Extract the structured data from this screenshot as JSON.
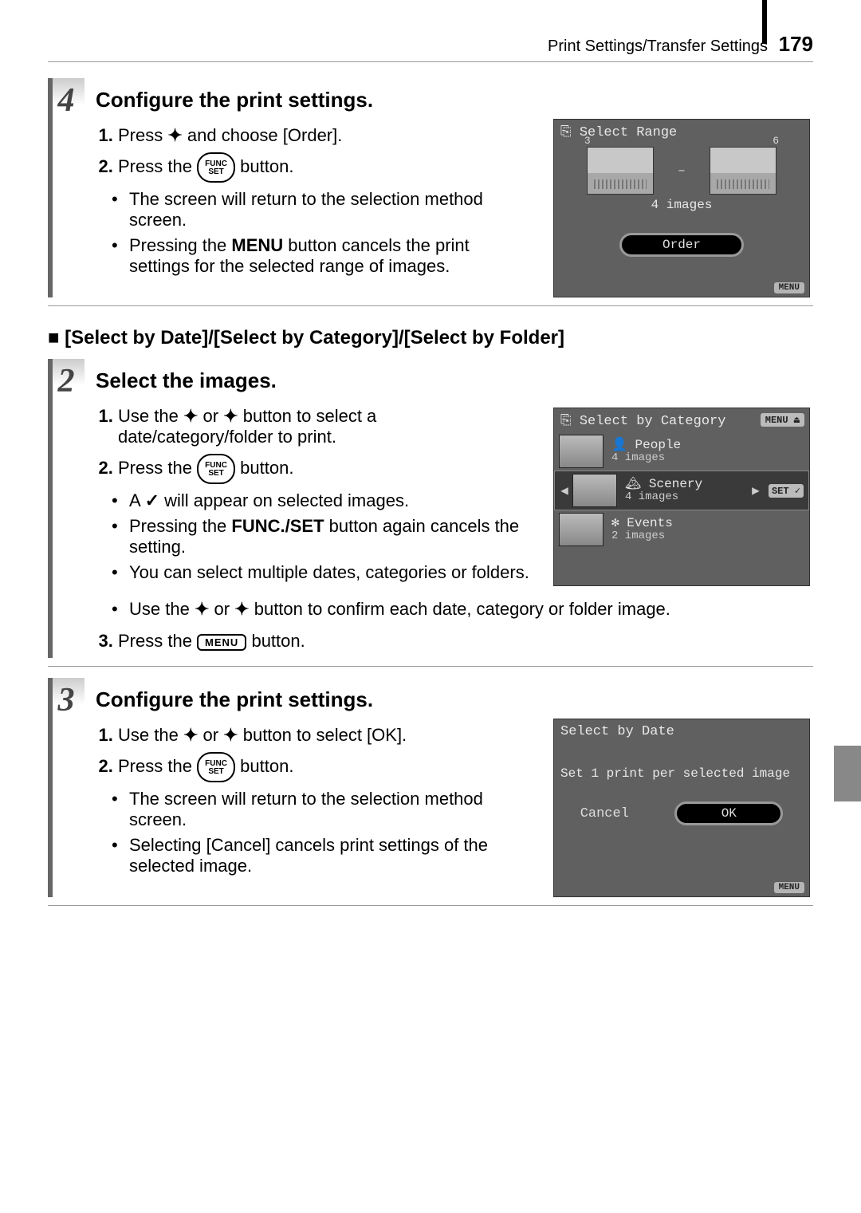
{
  "header": {
    "breadcrumb": "Print Settings/Transfer Settings",
    "page_number": "179"
  },
  "section_heading": "■ [Select by Date]/[Select by Category]/[Select by Folder]",
  "buttons": {
    "func_top": "FUNC",
    "func_bottom": "SET",
    "menu_label": "MENU",
    "menu_strong": "MENU",
    "funcset_strong": "FUNC./SET"
  },
  "step4": {
    "num": "4",
    "title": "Configure the print settings.",
    "i1a": "Press ",
    "i1b": " and choose [Order].",
    "i2a": "Press the ",
    "i2b": " button.",
    "n1": "The screen will return to the selection method screen.",
    "n2a": "Pressing the ",
    "n2b": " button cancels the print settings for the selected range of images.",
    "screen": {
      "title": "Select Range",
      "left_num": "3",
      "right_num": "6",
      "count": "4 images",
      "order": "Order",
      "menu_back": "MENU"
    }
  },
  "step2": {
    "num": "2",
    "title": "Select the images.",
    "i1a": "Use the ",
    "i1b": " or ",
    "i1c": " button to select a date/category/folder to print.",
    "i2a": "Press the ",
    "i2b": " button.",
    "n1a": "A ",
    "n1b": " will appear on selected images.",
    "n2a": "Pressing the ",
    "n2b": " button again cancels the setting.",
    "n3": "You can select multiple dates, categories or folders.",
    "n4a": "Use the ",
    "n4b": " or ",
    "n4c": " button to confirm each date, category or folder image.",
    "i3a": "Press the ",
    "i3b": " button.",
    "screen": {
      "title": "Select by Category",
      "badge": "MENU",
      "rows": [
        {
          "label": "People",
          "count": "4 images"
        },
        {
          "label": "Scenery",
          "count": "4 images"
        },
        {
          "label": "Events",
          "count": "2 images"
        }
      ],
      "set_badge": "SET ✓"
    }
  },
  "step3": {
    "num": "3",
    "title": "Configure the print settings.",
    "i1a": "Use the ",
    "i1b": " or ",
    "i1c": " button to select [OK].",
    "i2a": "Press the ",
    "i2b": " button.",
    "n1": "The screen will return to the selection method screen.",
    "n2": "Selecting [Cancel] cancels print settings of the selected image.",
    "screen": {
      "title": "Select by Date",
      "msg": "Set 1 print per selected image",
      "cancel": "Cancel",
      "ok": "OK",
      "menu_back": "MENU"
    }
  }
}
